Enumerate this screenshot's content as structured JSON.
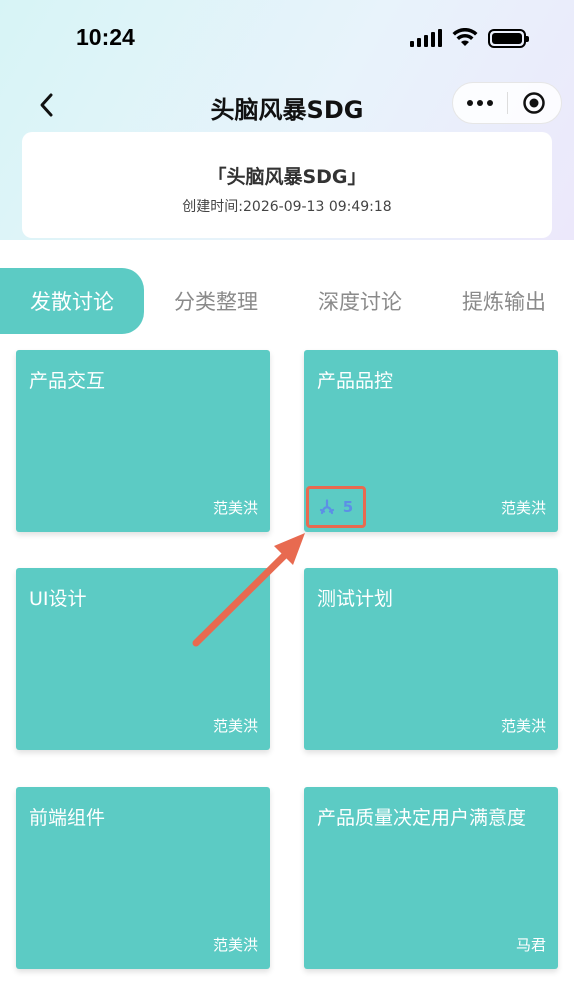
{
  "status_bar": {
    "time": "10:24"
  },
  "nav": {
    "title": "头脑风暴SDG"
  },
  "info": {
    "title": "「头脑风暴SDG」",
    "created": "创建时间:2026-09-13 09:49:18"
  },
  "tabs": [
    {
      "label": "发散讨论",
      "active": true
    },
    {
      "label": "分类整理",
      "active": false
    },
    {
      "label": "深度讨论",
      "active": false
    },
    {
      "label": "提炼输出",
      "active": false
    }
  ],
  "cards": [
    {
      "title": "产品交互",
      "author": "范美洪"
    },
    {
      "title": "产品品控",
      "author": "范美洪",
      "likes": "5"
    },
    {
      "title": "UI设计",
      "author": "范美洪"
    },
    {
      "title": "测试计划",
      "author": "范美洪"
    },
    {
      "title": "前端组件",
      "author": "范美洪"
    },
    {
      "title": "产品质量决定用户满意度",
      "author": "马君"
    }
  ],
  "colors": {
    "accent": "#5ccbc4",
    "highlight": "#e86a50",
    "like": "#5c8fe6"
  }
}
